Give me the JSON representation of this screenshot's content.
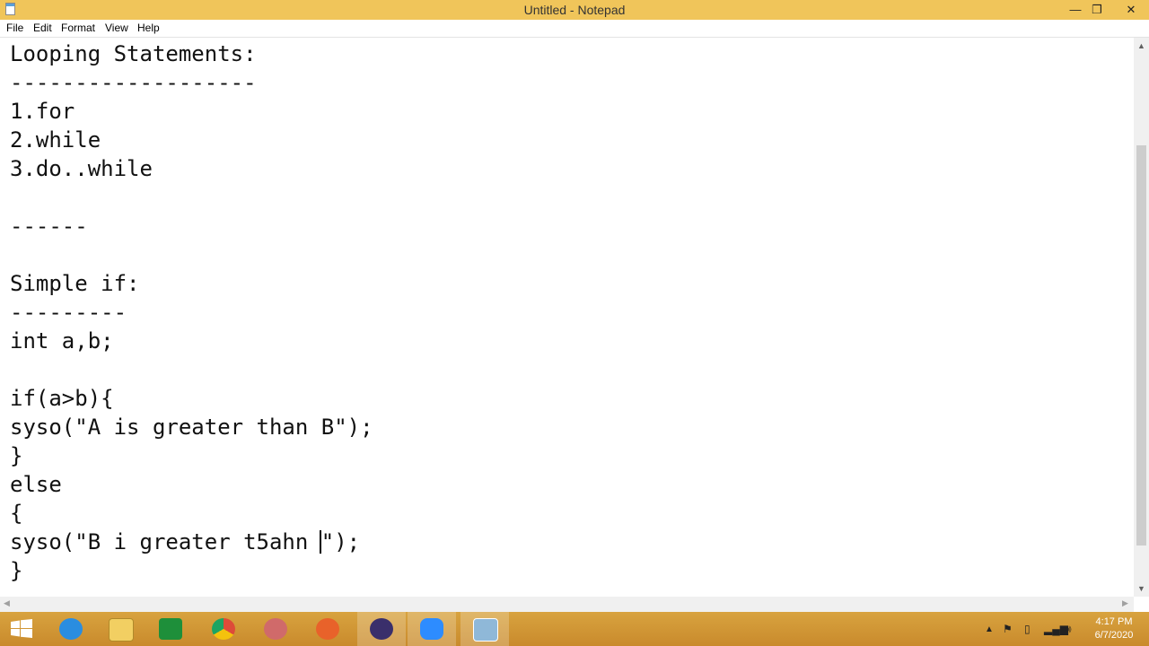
{
  "window": {
    "title": "Untitled - Notepad",
    "controls": {
      "minimize": "—",
      "restore": "❐",
      "close": "✕"
    }
  },
  "menu": [
    "File",
    "Edit",
    "Format",
    "View",
    "Help"
  ],
  "editor": {
    "lines": [
      "Looping Statements:",
      "-------------------",
      "1.for",
      "2.while",
      "3.do..while",
      "",
      "------",
      "",
      "Simple if:",
      "---------",
      "int a,b;",
      "",
      "if(a>b){",
      "syso(\"A is greater than B\");",
      "}",
      "else",
      "{",
      "syso(\"B i greater t5ahn ",
      "}"
    ],
    "caret_line_tail": "\");"
  },
  "taskbar": {
    "apps": [
      {
        "name": "start-button",
        "icon": "windows-logo",
        "color": "#ffffff"
      },
      {
        "name": "internet-explorer",
        "icon": "ie-icon",
        "color": "#2a8de0"
      },
      {
        "name": "file-explorer",
        "icon": "folder-icon",
        "color": "#f2cf62"
      },
      {
        "name": "excel",
        "icon": "excel-icon",
        "color": "#1e8f3a"
      },
      {
        "name": "chrome",
        "icon": "chrome-icon",
        "color": "#dd4b39"
      },
      {
        "name": "paint",
        "icon": "paint-icon",
        "color": "#d06a6a"
      },
      {
        "name": "firefox",
        "icon": "firefox-icon",
        "color": "#e8622a"
      },
      {
        "name": "eclipse",
        "icon": "eclipse-icon",
        "color": "#3a2f6b"
      },
      {
        "name": "zoom",
        "icon": "zoom-icon",
        "color": "#2d8cff"
      },
      {
        "name": "notepad",
        "icon": "notepad-icon",
        "color": "#8fb8d8"
      }
    ],
    "clock": {
      "time": "4:17 PM",
      "date": "6/7/2020"
    }
  }
}
